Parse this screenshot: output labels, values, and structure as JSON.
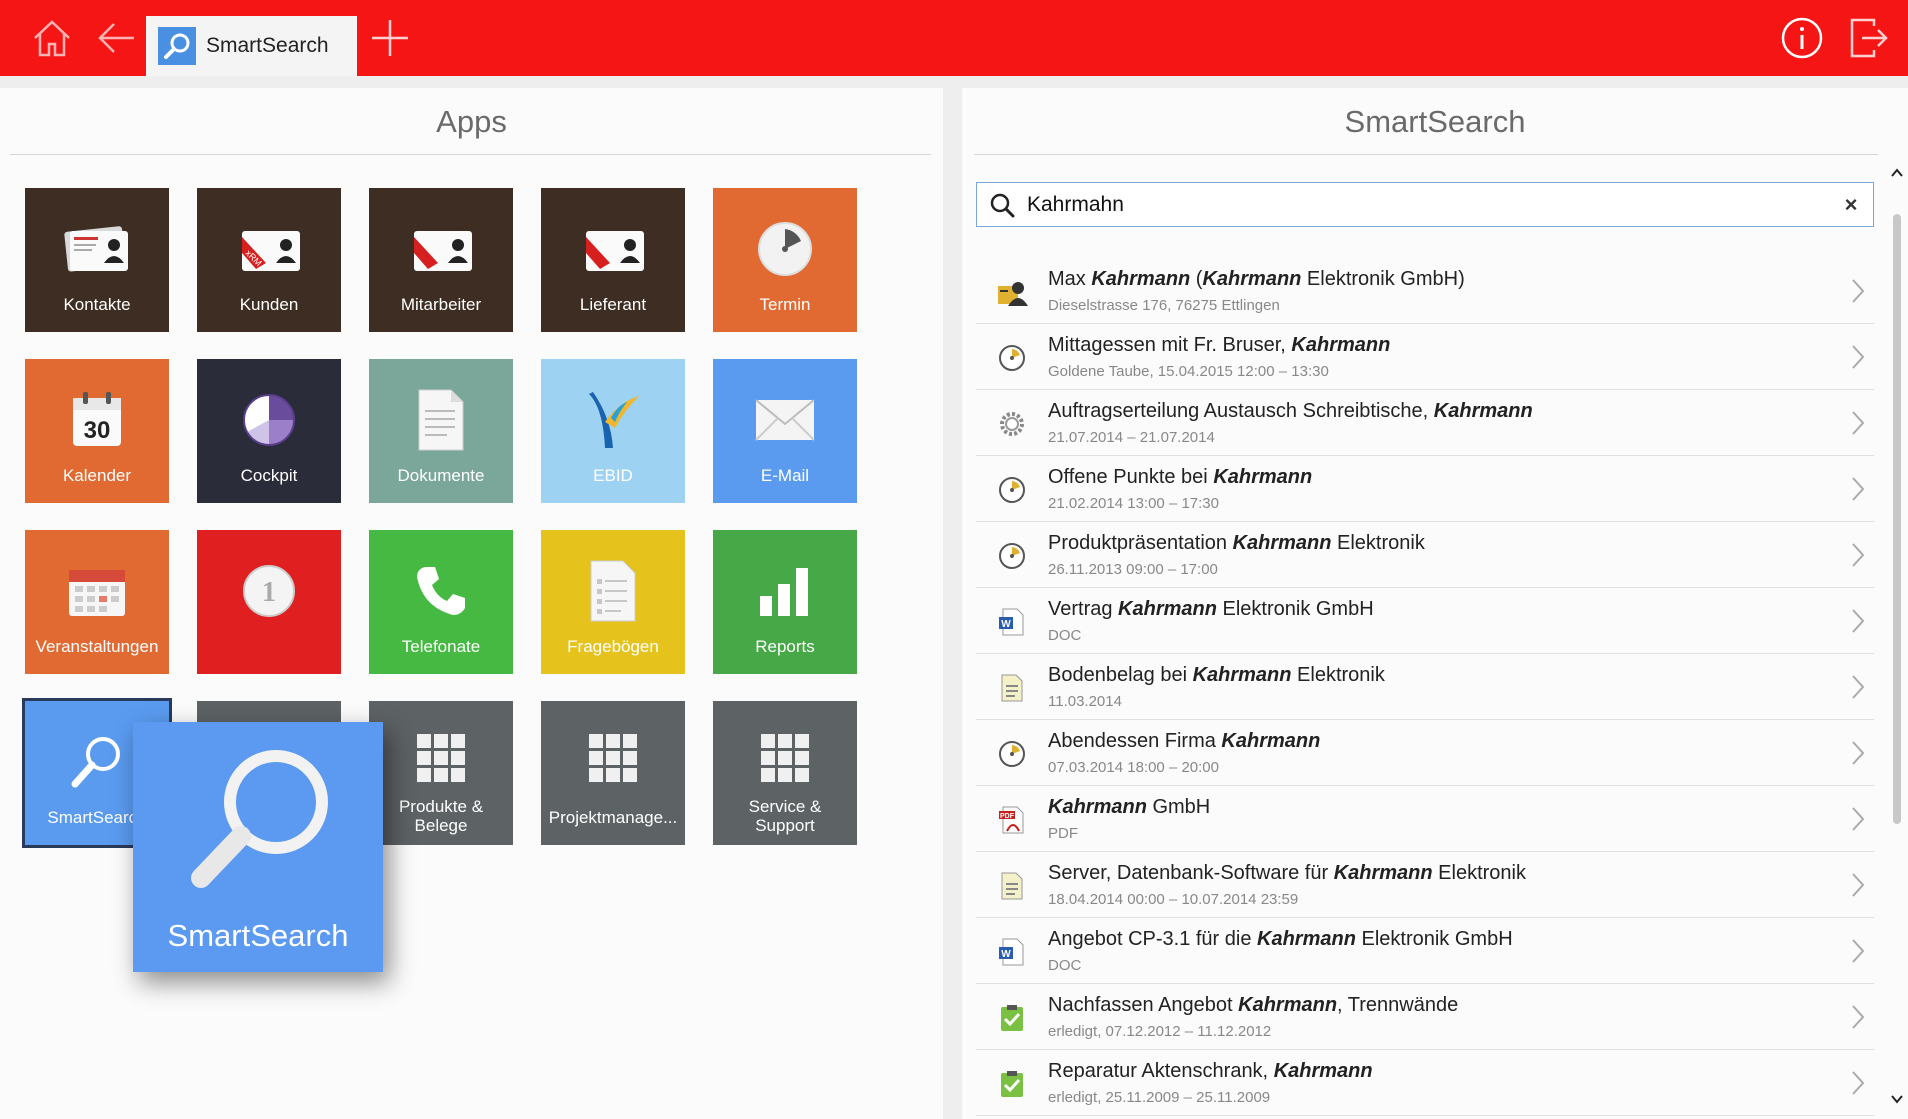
{
  "topbar": {
    "tab_label": "SmartSearch",
    "colors": {
      "bar": "#f51515",
      "tab_icon": "#4a90e2"
    },
    "icons": [
      "home-icon",
      "back-arrow-icon",
      "search-icon",
      "plus-icon",
      "info-icon",
      "exit-icon"
    ]
  },
  "apps": {
    "title": "Apps",
    "tiles": [
      {
        "label": "Kontakte",
        "color": "#3d2d22",
        "icon": "contact-card-icon"
      },
      {
        "label": "Kunden",
        "color": "#3d2d22",
        "icon": "xrm-card-icon"
      },
      {
        "label": "Mitarbeiter",
        "color": "#3d2d22",
        "icon": "xrm-card-icon"
      },
      {
        "label": "Lieferant",
        "color": "#3d2d22",
        "icon": "xrm-card-icon"
      },
      {
        "label": "Termin",
        "color": "#e06a32",
        "icon": "clock-icon"
      },
      {
        "label": "Kalender",
        "color": "#e06a32",
        "icon": "calendar-icon",
        "day": "30"
      },
      {
        "label": "Cockpit",
        "color": "#2a2c3a",
        "icon": "pie-chart-icon"
      },
      {
        "label": "Dokumente",
        "color": "#7ba79b",
        "icon": "document-icon"
      },
      {
        "label": "EBID",
        "color": "#9ed2f2",
        "icon": "ebid-logo-icon"
      },
      {
        "label": "E-Mail",
        "color": "#5a9bf0",
        "icon": "envelope-icon"
      },
      {
        "label": "Veranstaltungen",
        "color": "#e06a32",
        "icon": "event-calendar-icon"
      },
      {
        "label": "",
        "color": "#e02020",
        "icon": "task-counter-icon",
        "badge": "1"
      },
      {
        "label": "Telefonate",
        "color": "#46b943",
        "icon": "phone-icon"
      },
      {
        "label": "Fragebögen",
        "color": "#e6c21d",
        "icon": "questionnaire-icon"
      },
      {
        "label": "Reports",
        "color": "#46a846",
        "icon": "bar-chart-icon"
      },
      {
        "label": "SmartSearch",
        "color": "#5a9bf0",
        "icon": "search-icon"
      },
      {
        "label": "",
        "color": "#5d6264",
        "icon": "grid-icon"
      },
      {
        "label": "Produkte & Belege",
        "color": "#5d6264",
        "icon": "grid-icon"
      },
      {
        "label": "Projektmanage...",
        "color": "#5d6264",
        "icon": "grid-icon"
      },
      {
        "label": "Service & Support",
        "color": "#5d6264",
        "icon": "grid-icon"
      }
    ],
    "popup": {
      "label": "SmartSearch",
      "color": "#5b9af0"
    }
  },
  "smartsearch": {
    "title": "SmartSearch",
    "query": "Kahrmahn",
    "clear_label": "×",
    "results": [
      {
        "icon": "contact-person-icon",
        "title": [
          [
            "Max ",
            false
          ],
          [
            "Kahrmann",
            true
          ],
          [
            " (",
            false
          ],
          [
            "Kahrmann",
            true
          ],
          [
            " Elektronik GmbH)",
            false
          ]
        ],
        "subtitle": "Dieselstrasse 176, 76275 Ettlingen"
      },
      {
        "icon": "appointment-clock-icon",
        "title": [
          [
            "Mittagessen mit Fr. Bruser, ",
            false
          ],
          [
            "Kahrmann",
            true
          ]
        ],
        "subtitle": "Goldene Taube, 15.04.2015 12:00 – 13:30"
      },
      {
        "icon": "gear-icon",
        "title": [
          [
            "Auftragserteilung Austausch Schreibtische, ",
            false
          ],
          [
            "Kahrmann",
            true
          ]
        ],
        "subtitle": "21.07.2014 – 21.07.2014"
      },
      {
        "icon": "appointment-clock-icon",
        "title": [
          [
            "Offene Punkte bei ",
            false
          ],
          [
            "Kahrmann",
            true
          ]
        ],
        "subtitle": "21.02.2014 13:00 – 17:30"
      },
      {
        "icon": "appointment-clock-icon",
        "title": [
          [
            "Produktpräsentation ",
            false
          ],
          [
            "Kahrmann",
            true
          ],
          [
            " Elektronik",
            false
          ]
        ],
        "subtitle": "26.11.2013 09:00 – 17:00"
      },
      {
        "icon": "word-doc-icon",
        "title": [
          [
            "Vertrag ",
            false
          ],
          [
            "Kahrmann",
            true
          ],
          [
            " Elektronik GmbH",
            false
          ]
        ],
        "subtitle": "DOC"
      },
      {
        "icon": "note-icon",
        "title": [
          [
            "Bodenbelag bei ",
            false
          ],
          [
            "Kahrmann",
            true
          ],
          [
            " Elektronik",
            false
          ]
        ],
        "subtitle": "11.03.2014"
      },
      {
        "icon": "appointment-clock-icon",
        "title": [
          [
            "Abendessen Firma ",
            false
          ],
          [
            "Kahrmann",
            true
          ]
        ],
        "subtitle": "07.03.2014 18:00 – 20:00"
      },
      {
        "icon": "pdf-icon",
        "title": [
          [
            "Kahrmann",
            true
          ],
          [
            " GmbH",
            false
          ]
        ],
        "subtitle": "PDF"
      },
      {
        "icon": "note-icon",
        "title": [
          [
            "Server, Datenbank-Software für ",
            false
          ],
          [
            "Kahrmann",
            true
          ],
          [
            " Elektronik",
            false
          ]
        ],
        "subtitle": "18.04.2014 00:00 – 10.07.2014 23:59"
      },
      {
        "icon": "word-doc-icon",
        "title": [
          [
            "Angebot CP-3.1 für die ",
            false
          ],
          [
            "Kahrmann",
            true
          ],
          [
            " Elektronik GmbH",
            false
          ]
        ],
        "subtitle": "DOC"
      },
      {
        "icon": "task-check-icon",
        "title": [
          [
            "Nachfassen Angebot ",
            false
          ],
          [
            "Kahrmann",
            true
          ],
          [
            ", Trennwände",
            false
          ]
        ],
        "subtitle": "erledigt, 07.12.2012 – 11.12.2012"
      },
      {
        "icon": "task-check-icon",
        "title": [
          [
            "Reparatur Aktenschrank, ",
            false
          ],
          [
            "Kahrmann",
            true
          ]
        ],
        "subtitle": "erledigt, 25.11.2009 – 25.11.2009"
      }
    ]
  }
}
